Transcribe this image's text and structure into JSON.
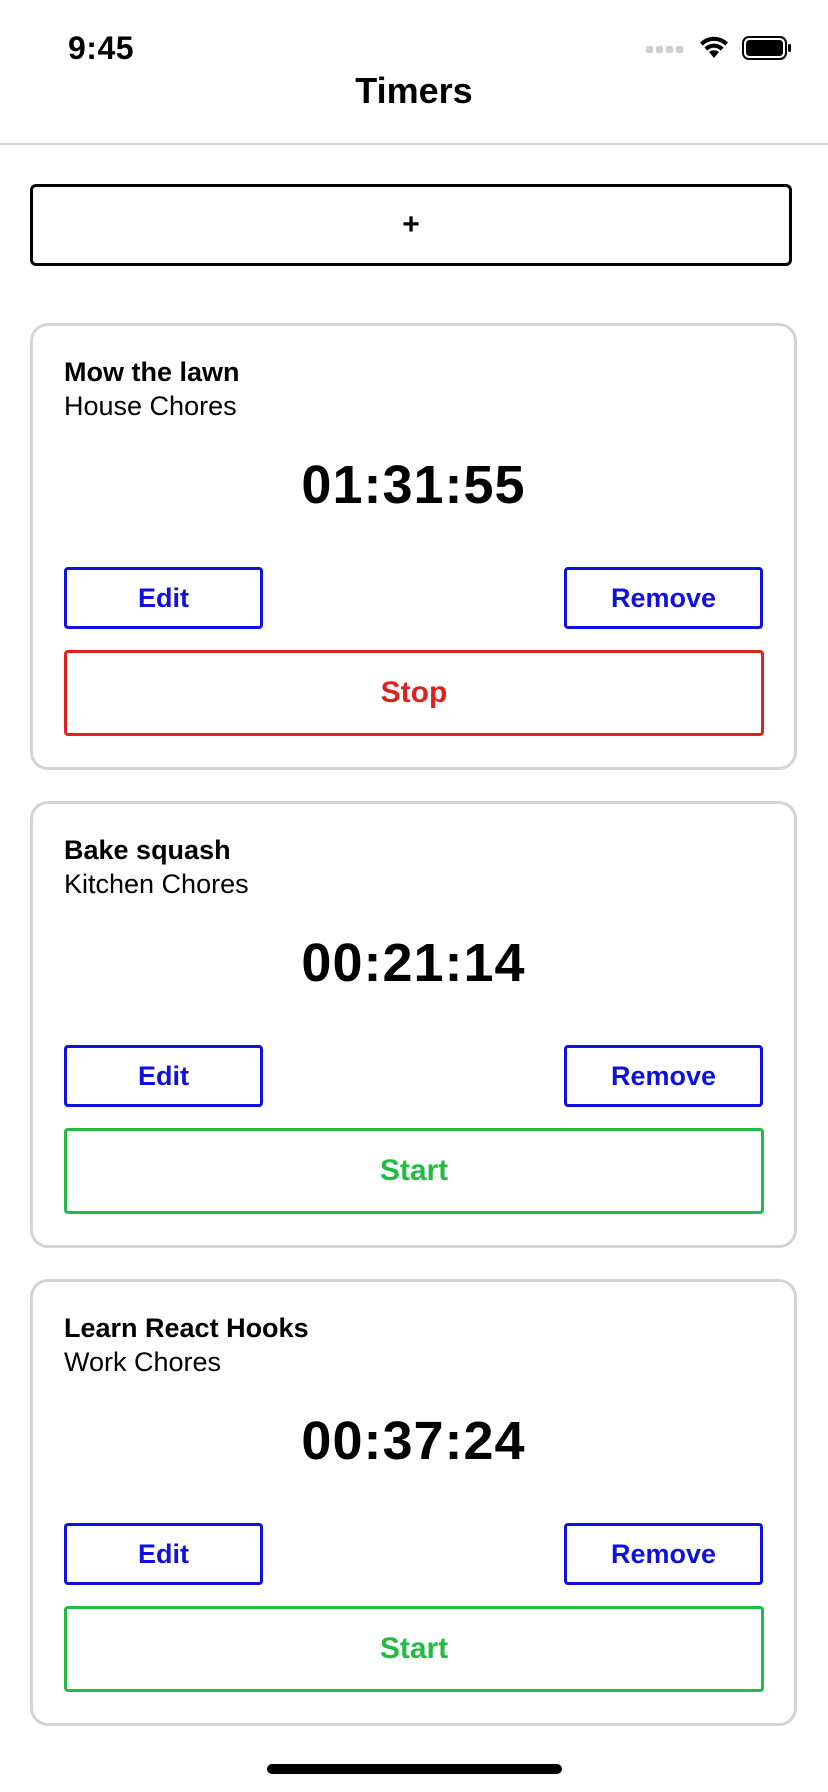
{
  "status_bar": {
    "time": "9:45",
    "icons": [
      "cellular-signal-icon",
      "wifi-icon",
      "battery-icon"
    ]
  },
  "nav": {
    "title": "Timers"
  },
  "add_button": {
    "label": "+"
  },
  "colors": {
    "edit_remove": "#1111dd",
    "stop": "#dd2222",
    "start": "#22bb44",
    "card_border": "#d4d4d4"
  },
  "timers": [
    {
      "title": "Mow the lawn",
      "project": "House Chores",
      "elapsed": "01:31:55",
      "edit_label": "Edit",
      "remove_label": "Remove",
      "toggle_label": "Stop",
      "running": true
    },
    {
      "title": "Bake squash",
      "project": "Kitchen Chores",
      "elapsed": "00:21:14",
      "edit_label": "Edit",
      "remove_label": "Remove",
      "toggle_label": "Start",
      "running": false
    },
    {
      "title": "Learn React Hooks",
      "project": "Work Chores",
      "elapsed": "00:37:24",
      "edit_label": "Edit",
      "remove_label": "Remove",
      "toggle_label": "Start",
      "running": false
    }
  ]
}
